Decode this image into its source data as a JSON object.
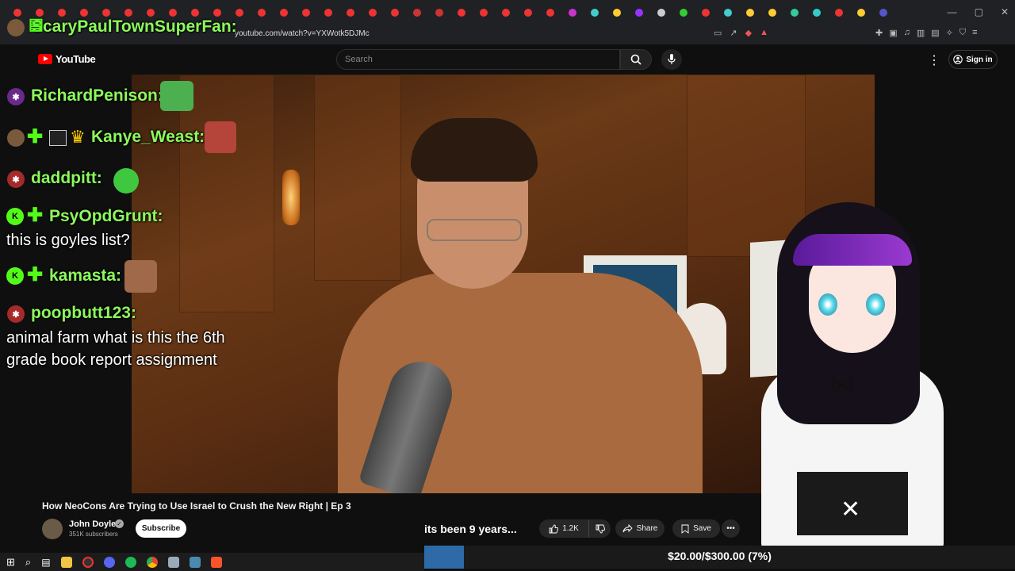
{
  "browser": {
    "url": "youtube.com/watch?v=YXWotk5DJMc",
    "tab_count": 40,
    "tab_favicon_colors": [
      "#e33",
      "#e33",
      "#e33",
      "#e33",
      "#e33",
      "#e33",
      "#e33",
      "#e33",
      "#e33",
      "#e33",
      "#e33",
      "#e33",
      "#e33",
      "#e33",
      "#e33",
      "#e33",
      "#e33",
      "#e33",
      "#c33",
      "#c33",
      "#e33",
      "#e33",
      "#e33",
      "#e33",
      "#e33",
      "#c3c",
      "#4cc",
      "#fc3",
      "#93f",
      "#ccc",
      "#3c3",
      "#e33",
      "#4cc",
      "#fc3",
      "#fc3",
      "#3c9",
      "#3cc",
      "#e33",
      "#fc3",
      "#55c"
    ]
  },
  "youtube": {
    "logo_text": "YouTube",
    "search_placeholder": "Search",
    "sign_in": "Sign in",
    "video_title": "How NeoCons Are Trying to Use Israel to Crush the New Right | Ep 3",
    "channel_name": "John Doyle",
    "subscribers": "351K subscribers",
    "subscribe_label": "Subscribe",
    "likes": "1.2K",
    "share_label": "Share",
    "save_label": "Save"
  },
  "overlay": {
    "top_user": "ScaryPaulTownSuperFan:",
    "chat": [
      {
        "user": "RichardPenison:",
        "message": "",
        "badge": "purple"
      },
      {
        "user": "Kanye_Weast:",
        "message": "",
        "badge": "avatar"
      },
      {
        "user": "daddpitt:",
        "message": "",
        "badge": "red"
      },
      {
        "user": "PsyOpdGrunt:",
        "message": "this is goyles list?",
        "badge": "green"
      },
      {
        "user": "kamasta:",
        "message": "",
        "badge": "green"
      },
      {
        "user": "poopbutt123:",
        "message": "animal farm what is this the 6th grade book report assignment",
        "badge": "red"
      }
    ],
    "caption": "its been 9 years...",
    "goal_text": "$20.00/$300.00 (7%)",
    "goal_fraction": 0.0667,
    "goal_color": "#2e6aa8"
  },
  "icons": {
    "search": "search-icon",
    "mic": "mic-icon",
    "user": "user-circle-icon",
    "like": "thumbs-up-icon",
    "dislike": "thumbs-down-icon",
    "share": "share-arrow-icon",
    "save": "bookmark-icon",
    "more": "more-horizontal-icon"
  },
  "colors": {
    "chat_name": "#8cfa5c",
    "yt_red": "#ff0000",
    "background": "#0f0f0f"
  }
}
